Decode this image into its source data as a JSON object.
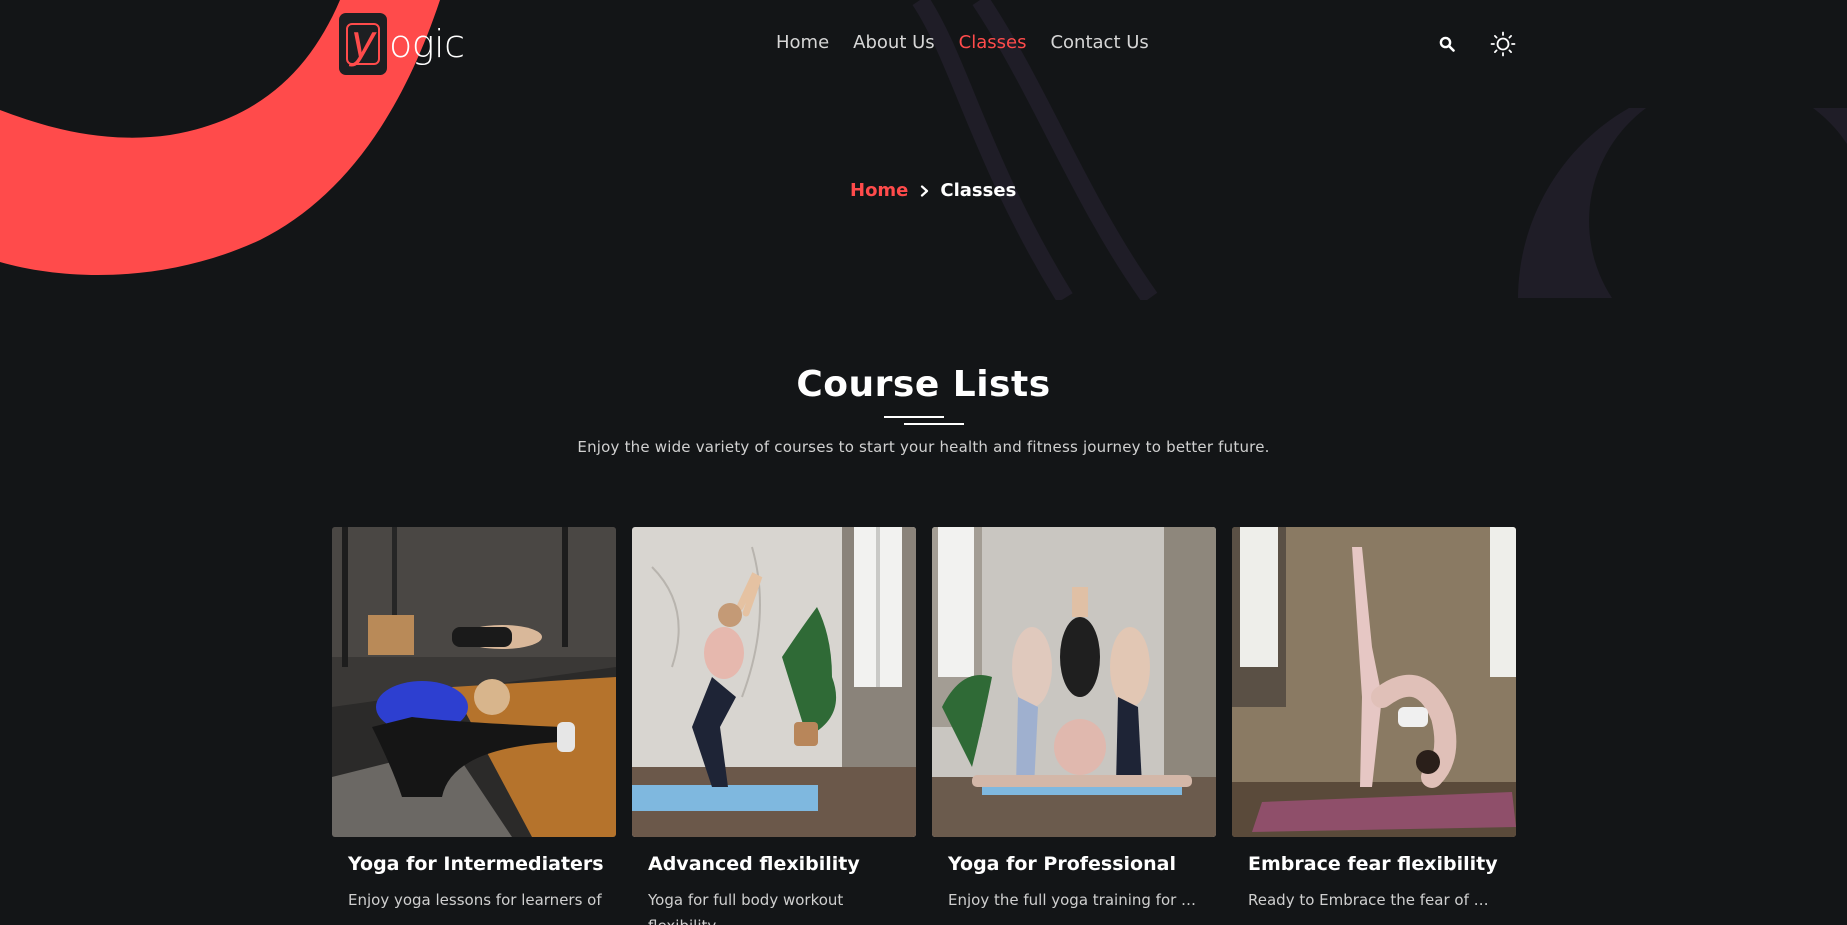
{
  "brand": {
    "logo_letter": "y",
    "logo_text": "ogic",
    "accent_color": "#ff4b4b",
    "background_color": "#131517"
  },
  "nav": {
    "items": [
      {
        "label": "Home",
        "active": false
      },
      {
        "label": "About Us",
        "active": false
      },
      {
        "label": "Classes",
        "active": true
      },
      {
        "label": "Contact Us",
        "active": false
      }
    ],
    "search_icon": "search-icon",
    "theme_icon": "sun-icon"
  },
  "breadcrumb": {
    "home": "Home",
    "separator_icon": "chevron-right-icon",
    "current": "Classes"
  },
  "section": {
    "title": "Course Lists",
    "subtitle": "Enjoy the wide variety of courses to start your health and fitness journey to better future."
  },
  "courses": [
    {
      "title": "Yoga for Intermediaters",
      "description": "Enjoy yoga lessons for learners of …"
    },
    {
      "title": "Advanced flexibility",
      "description": "Yoga for full body workout flexibility …"
    },
    {
      "title": "Yoga for Professional",
      "description": "Enjoy the full yoga training for …"
    },
    {
      "title": "Embrace fear flexibility",
      "description": "Ready to Embrace the fear of …"
    }
  ]
}
